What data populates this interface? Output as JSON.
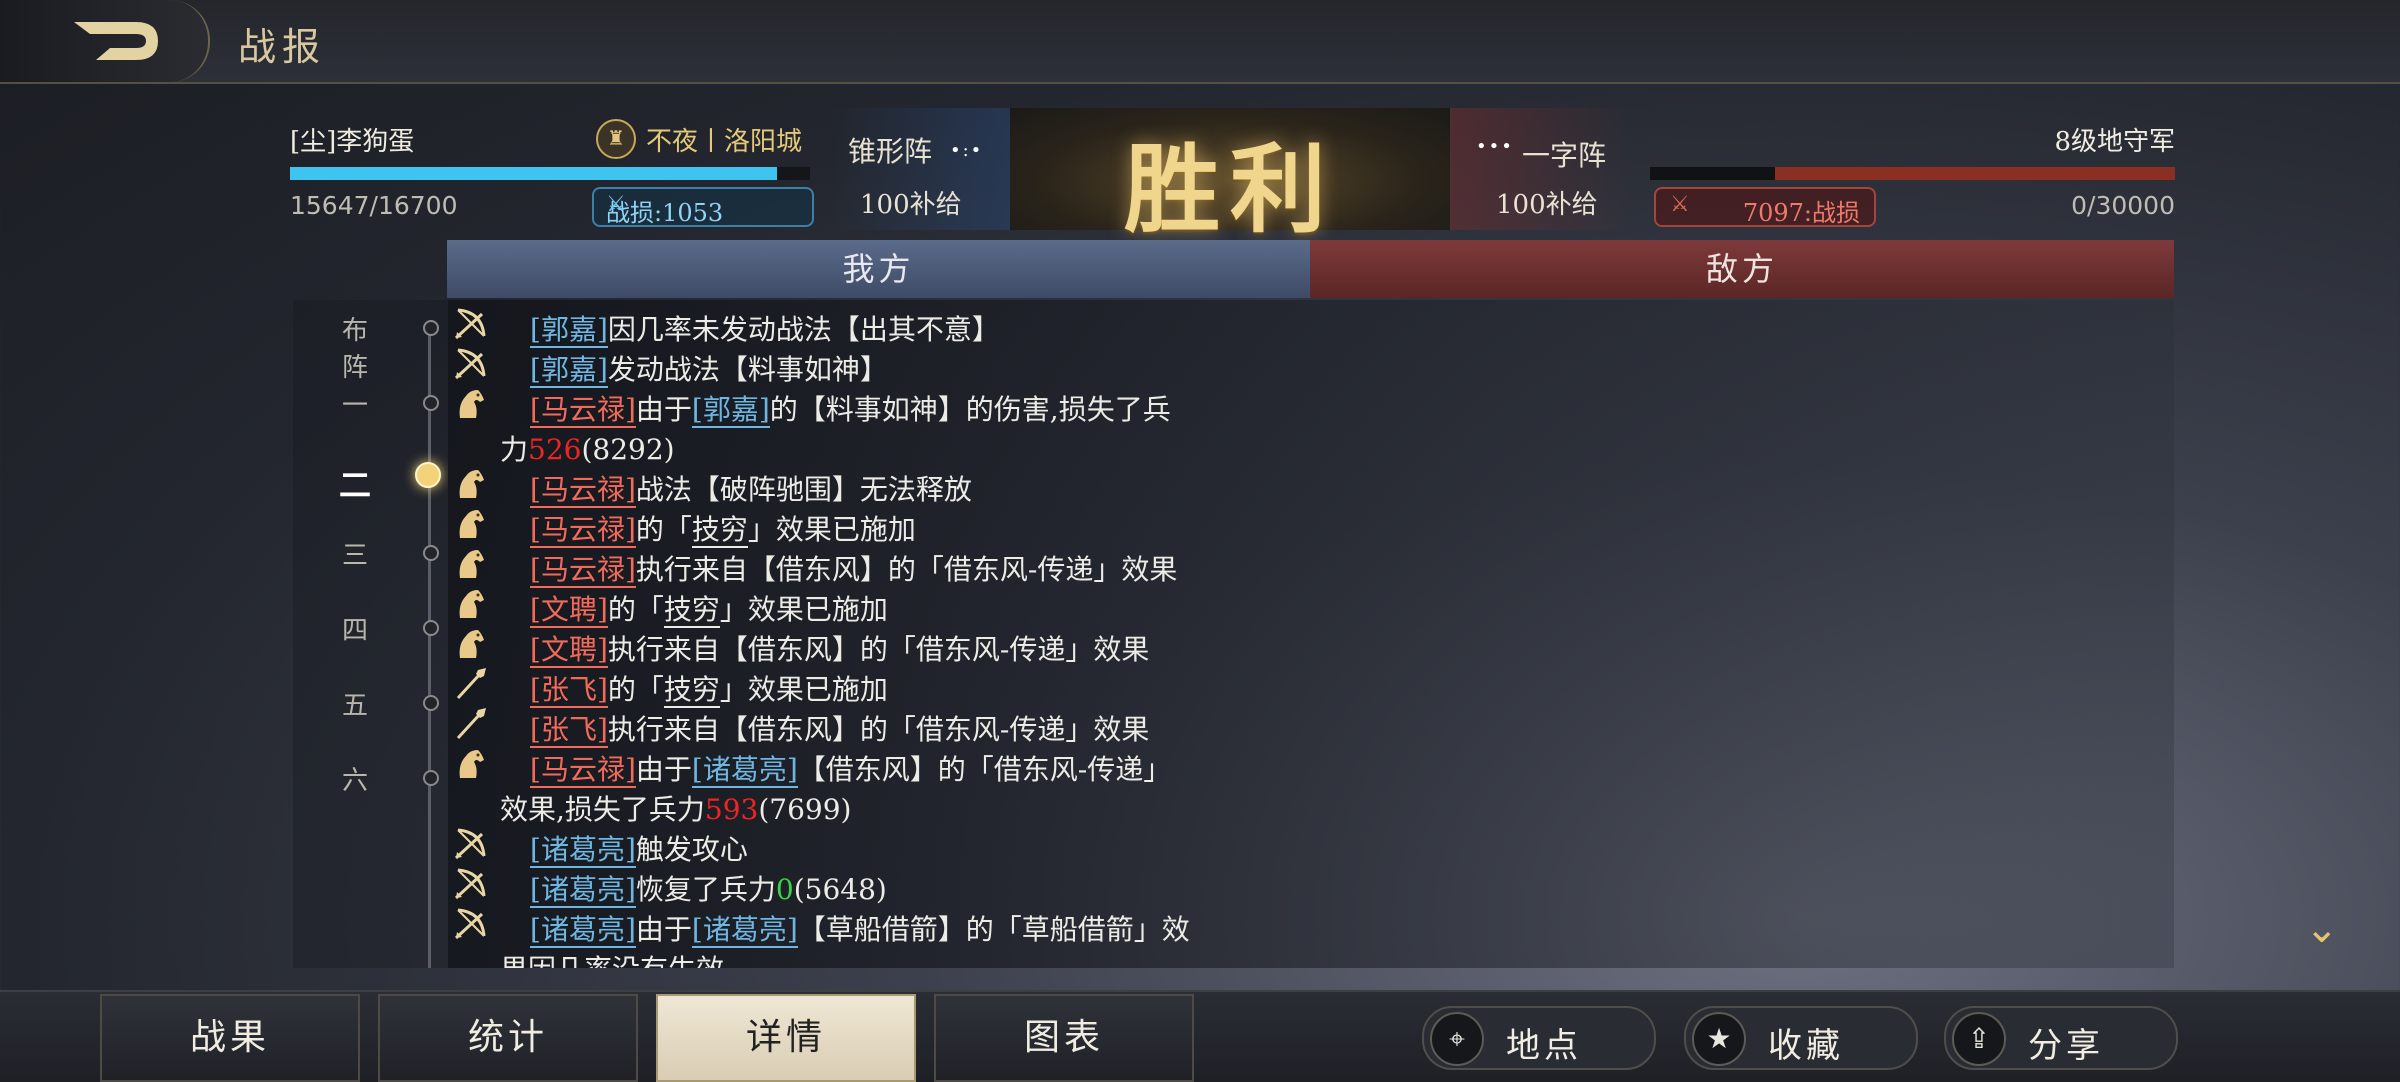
{
  "header": {
    "title": "战报"
  },
  "ally": {
    "name": "[尘]李狗蛋",
    "city": "不夜丨洛阳城",
    "troops": "15647/16700",
    "troops_fraction": 0.937,
    "loss": "战损:1053",
    "formation": "锥形阵",
    "supply": "100补给"
  },
  "enemy": {
    "name": "8级地守军",
    "troops": "0/30000",
    "troops_fraction": 0.0,
    "loss": "7097:战损",
    "formation": "一字阵",
    "supply": "100补给"
  },
  "result": "胜利",
  "tabs": {
    "ally": "我方",
    "enemy": "敌方"
  },
  "rounds": [
    {
      "label": "布阵",
      "active": false
    },
    {
      "label": "一",
      "active": false
    },
    {
      "label": "二",
      "active": true
    },
    {
      "label": "三",
      "active": false
    },
    {
      "label": "四",
      "active": false
    },
    {
      "label": "五",
      "active": false
    },
    {
      "label": "六",
      "active": false
    }
  ],
  "log": [
    {
      "icon": "bow",
      "parts": [
        {
          "t": "郭嘉",
          "c": "ally"
        },
        {
          "t": "因几率未发动战法【出其不意】"
        }
      ]
    },
    {
      "icon": "bow",
      "parts": [
        {
          "t": "郭嘉",
          "c": "ally"
        },
        {
          "t": "发动战法【料事如神】"
        }
      ]
    },
    {
      "icon": "horse",
      "parts": [
        {
          "t": "马云禄",
          "c": "foe"
        },
        {
          "t": "由于"
        },
        {
          "t": "郭嘉",
          "c": "ally"
        },
        {
          "t": "的【料事如神】的伤害,损失了兵"
        }
      ]
    },
    {
      "icon": "",
      "parts": [
        {
          "t": "力"
        },
        {
          "t": "526",
          "c": "dmg"
        },
        {
          "t": "(8292)"
        }
      ]
    },
    {
      "icon": "horse",
      "parts": [
        {
          "t": "马云禄",
          "c": "foe"
        },
        {
          "t": "战法【破阵驰围】无法释放"
        }
      ]
    },
    {
      "icon": "horse",
      "parts": [
        {
          "t": "马云禄",
          "c": "foe"
        },
        {
          "t": "的「"
        },
        {
          "t": "技穷",
          "c": "under"
        },
        {
          "t": "」效果已施加"
        }
      ]
    },
    {
      "icon": "horse",
      "parts": [
        {
          "t": "马云禄",
          "c": "foe"
        },
        {
          "t": "执行来自【借东风】的「借东风-传递」效果"
        }
      ]
    },
    {
      "icon": "horse",
      "parts": [
        {
          "t": "文聘",
          "c": "foe"
        },
        {
          "t": "的「"
        },
        {
          "t": "技穷",
          "c": "under"
        },
        {
          "t": "」效果已施加"
        }
      ]
    },
    {
      "icon": "horse",
      "parts": [
        {
          "t": "文聘",
          "c": "foe"
        },
        {
          "t": "执行来自【借东风】的「借东风-传递」效果"
        }
      ]
    },
    {
      "icon": "spear",
      "parts": [
        {
          "t": "张飞",
          "c": "foe"
        },
        {
          "t": "的「"
        },
        {
          "t": "技穷",
          "c": "under"
        },
        {
          "t": "」效果已施加"
        }
      ]
    },
    {
      "icon": "spear",
      "parts": [
        {
          "t": "张飞",
          "c": "foe"
        },
        {
          "t": "执行来自【借东风】的「借东风-传递」效果"
        }
      ]
    },
    {
      "icon": "horse",
      "parts": [
        {
          "t": "马云禄",
          "c": "foe"
        },
        {
          "t": "由于"
        },
        {
          "t": "诸葛亮",
          "c": "ally"
        },
        {
          "t": "【借东风】的「借东风-传递」"
        }
      ]
    },
    {
      "icon": "",
      "parts": [
        {
          "t": "效果,损失了兵力"
        },
        {
          "t": "593",
          "c": "dmg"
        },
        {
          "t": "(7699)"
        }
      ]
    },
    {
      "icon": "bow",
      "parts": [
        {
          "t": "诸葛亮",
          "c": "ally"
        },
        {
          "t": "触发攻心"
        }
      ]
    },
    {
      "icon": "bow",
      "parts": [
        {
          "t": "诸葛亮",
          "c": "ally"
        },
        {
          "t": "恢复了兵力"
        },
        {
          "t": "0",
          "c": "heal"
        },
        {
          "t": "(5648)"
        }
      ]
    },
    {
      "icon": "bow",
      "parts": [
        {
          "t": "诸葛亮",
          "c": "ally"
        },
        {
          "t": "由于"
        },
        {
          "t": "诸葛亮",
          "c": "ally"
        },
        {
          "t": "【草船借箭】的「草船借箭」效"
        }
      ]
    },
    {
      "icon": "",
      "parts": [
        {
          "t": "果因几率没有生效"
        }
      ]
    }
  ],
  "bottom_tabs": [
    "战果",
    "统计",
    "详情",
    "图表"
  ],
  "selected_tab": "详情",
  "actions": [
    {
      "label": "地点",
      "icon": "location-pin-icon"
    },
    {
      "label": "收藏",
      "icon": "star-icon"
    },
    {
      "label": "分享",
      "icon": "share-icon"
    }
  ],
  "colors": {
    "ally": "#6fb7e2",
    "foe": "#f26a5a",
    "damage": "#ee2424",
    "heal": "#38d34a",
    "gold": "#f0d58d"
  }
}
